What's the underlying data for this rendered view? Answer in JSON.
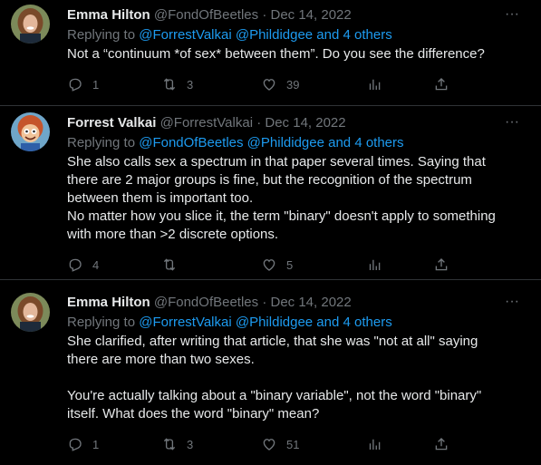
{
  "tweets": [
    {
      "author_name": "Emma Hilton",
      "handle": "@FondOfBeetles",
      "date": "· Dec 14, 2022",
      "replying_prefix": "Replying to",
      "replying_links": "@ForrestValkai @Phildidgee and 4 others",
      "text": "Not a “continuum *of sex* between them”. Do you see the difference?",
      "replies": "1",
      "retweets": "3",
      "likes": "39",
      "views": "",
      "avatar_icon": "woman-avatar"
    },
    {
      "author_name": "Forrest Valkai",
      "handle": "@ForrestValkai",
      "date": "· Dec 14, 2022",
      "replying_prefix": "Replying to",
      "replying_links": "@FondOfBeetles @Phildidgee and 4 others",
      "text": "She also calls sex a spectrum in that paper several times. Saying that\nthere are 2 major groups is fine, but the recognition of the spectrum\nbetween them is important too.\nNo matter how you slice it, the term \"binary\" doesn't apply to something\nwith more than >2 discrete options.",
      "replies": "4",
      "retweets": "",
      "likes": "5",
      "views": "",
      "avatar_icon": "cartoon-avatar"
    },
    {
      "author_name": "Emma Hilton",
      "handle": "@FondOfBeetles",
      "date": "· Dec 14, 2022",
      "replying_prefix": "Replying to",
      "replying_links": "@ForrestValkai @Phildidgee and 4 others",
      "text": "She clarified, after writing that article, that she was \"not at all\" saying\nthere are more than two sexes.\n\nYou're actually talking about a \"binary variable\", not the word \"binary\"\nitself. What does the word \"binary\" mean?",
      "replies": "1",
      "retweets": "3",
      "likes": "51",
      "views": "",
      "avatar_icon": "woman-avatar"
    }
  ],
  "more_label": "···",
  "colors": {
    "background": "#000000",
    "text": "#e7e9ea",
    "muted": "#71767b",
    "link": "#1d9bf0",
    "divider": "#2f3336"
  }
}
